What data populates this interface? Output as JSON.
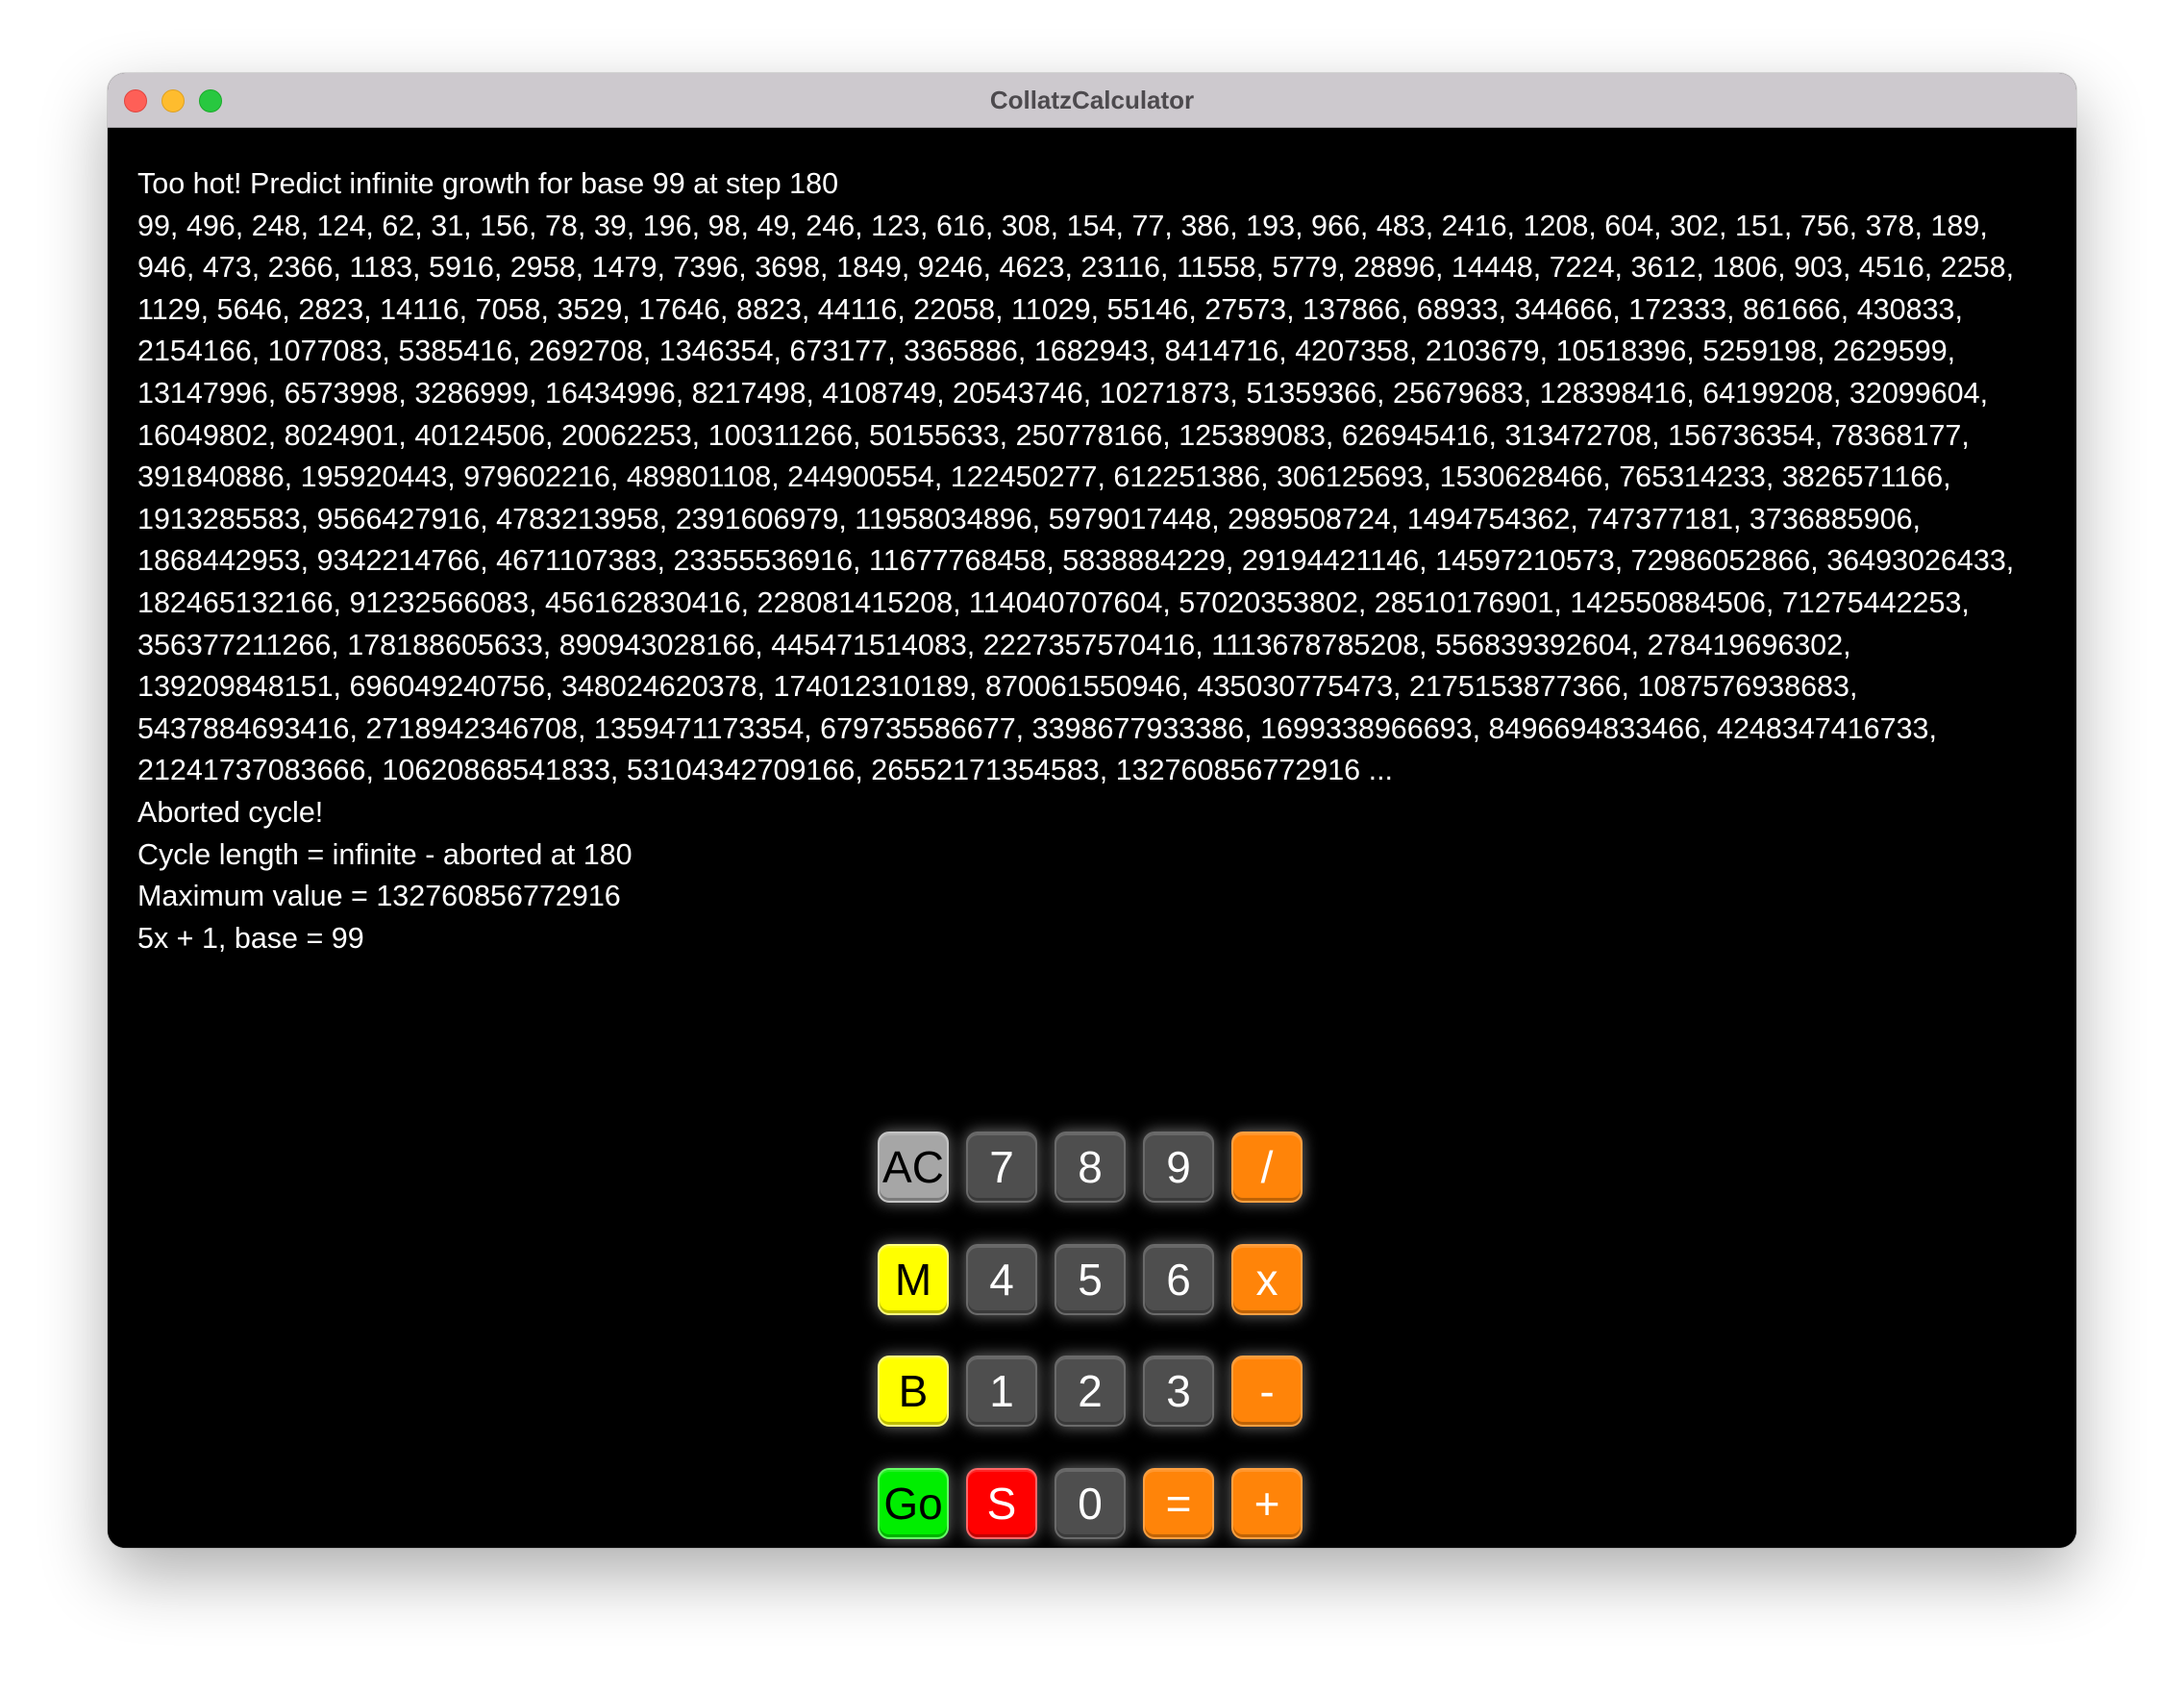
{
  "window": {
    "title": "CollatzCalculator"
  },
  "output": {
    "lines": [
      "Too hot! Predict infinite growth for base 99 at step 180",
      "99, 496, 248, 124, 62, 31, 156, 78, 39, 196, 98, 49, 246, 123, 616, 308, 154, 77, 386, 193, 966, 483, 2416, 1208, 604, 302, 151, 756, 378, 189,",
      "946, 473, 2366, 1183, 5916, 2958, 1479, 7396, 3698, 1849, 9246, 4623, 23116, 11558, 5779, 28896, 14448, 7224, 3612, 1806, 903, 4516, 2258,",
      "1129, 5646, 2823, 14116, 7058, 3529, 17646, 8823, 44116, 22058, 11029, 55146, 27573, 137866, 68933, 344666, 172333, 861666, 430833,",
      "2154166, 1077083, 5385416, 2692708, 1346354, 673177, 3365886, 1682943, 8414716, 4207358, 2103679, 10518396, 5259198, 2629599,",
      "13147996, 6573998, 3286999, 16434996, 8217498, 4108749, 20543746, 10271873, 51359366, 25679683, 128398416, 64199208, 32099604,",
      "16049802, 8024901, 40124506, 20062253, 100311266, 50155633, 250778166, 125389083, 626945416, 313472708, 156736354, 78368177,",
      "391840886, 195920443, 979602216, 489801108, 244900554, 122450277, 612251386, 306125693, 1530628466, 765314233, 3826571166,",
      "1913285583, 9566427916, 4783213958, 2391606979, 11958034896, 5979017448, 2989508724, 1494754362, 747377181, 3736885906,",
      "1868442953, 9342214766, 4671107383, 23355536916, 11677768458, 5838884229, 29194421146, 14597210573, 72986052866, 36493026433,",
      "182465132166, 91232566083, 456162830416, 228081415208, 114040707604, 57020353802, 28510176901, 142550884506, 71275442253,",
      "356377211266, 178188605633, 890943028166, 445471514083, 2227357570416, 1113678785208, 556839392604, 278419696302,",
      "139209848151, 696049240756, 348024620378, 174012310189, 870061550946, 435030775473, 2175153877366, 1087576938683,",
      "5437884693416, 2718942346708, 1359471173354, 679735586677, 3398677933386, 1699338966693, 8496694833466, 4248347416733,",
      "21241737083666, 10620868541833, 53104342709166, 26552171354583, 132760856772916 ...",
      "Aborted cycle!",
      "Cycle length = infinite - aborted at 180",
      "Maximum value = 132760856772916",
      "5x + 1, base = 99"
    ]
  },
  "keypad": {
    "rows": [
      [
        {
          "label": "AC",
          "name": "all-clear-button",
          "style": "light"
        },
        {
          "label": "7",
          "name": "digit-7-button",
          "style": "gray"
        },
        {
          "label": "8",
          "name": "digit-8-button",
          "style": "gray"
        },
        {
          "label": "9",
          "name": "digit-9-button",
          "style": "gray"
        },
        {
          "label": "/",
          "name": "divide-button",
          "style": "orange"
        }
      ],
      [
        {
          "label": "M",
          "name": "multiplier-button",
          "style": "yellow"
        },
        {
          "label": "4",
          "name": "digit-4-button",
          "style": "gray"
        },
        {
          "label": "5",
          "name": "digit-5-button",
          "style": "gray"
        },
        {
          "label": "6",
          "name": "digit-6-button",
          "style": "gray"
        },
        {
          "label": "x",
          "name": "multiply-button",
          "style": "orange"
        }
      ],
      [
        {
          "label": "B",
          "name": "base-button",
          "style": "yellow"
        },
        {
          "label": "1",
          "name": "digit-1-button",
          "style": "gray"
        },
        {
          "label": "2",
          "name": "digit-2-button",
          "style": "gray"
        },
        {
          "label": "3",
          "name": "digit-3-button",
          "style": "gray"
        },
        {
          "label": "-",
          "name": "subtract-button",
          "style": "orange"
        }
      ],
      [
        {
          "label": "Go",
          "name": "go-button",
          "style": "green"
        },
        {
          "label": "S",
          "name": "stop-button",
          "style": "red"
        },
        {
          "label": "0",
          "name": "digit-0-button",
          "style": "gray"
        },
        {
          "label": "=",
          "name": "equals-button",
          "style": "orange"
        },
        {
          "label": "+",
          "name": "add-button",
          "style": "orange"
        }
      ]
    ]
  },
  "colors": {
    "background": "#000000",
    "text": "#ffffff",
    "key_gray": "#4e4e4e",
    "key_light": "#a6a6a6",
    "key_orange": "#ff8409",
    "key_yellow": "#ffff00",
    "key_green": "#00ee00",
    "key_red": "#ff0000"
  }
}
